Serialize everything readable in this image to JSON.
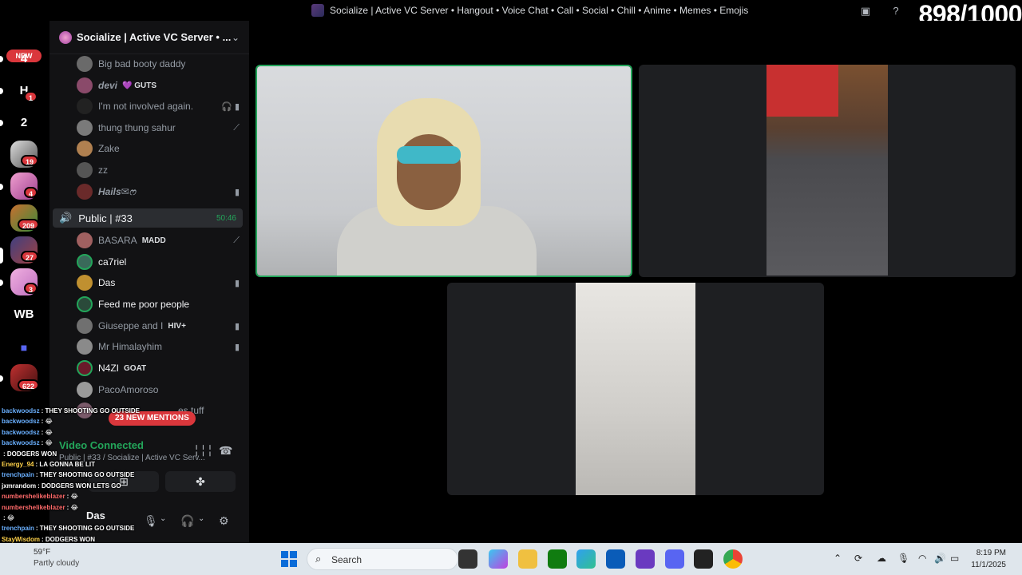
{
  "window": {
    "title": "Socialize | Active VC Server • Hangout • Voice Chat • Call • Social • Chill • Anime • Memes • Emojis",
    "counter": "898/1000"
  },
  "rail": {
    "new_pill": "NEW",
    "servers": [
      {
        "label": "4",
        "badge": ""
      },
      {
        "label": "H",
        "badge": "1"
      },
      {
        "label": "2",
        "badge": ""
      },
      {
        "label": "",
        "badge": "19"
      },
      {
        "label": "",
        "badge": "4"
      },
      {
        "label": "",
        "badge": "209"
      },
      {
        "label": "",
        "badge": "27"
      },
      {
        "label": "",
        "badge": "3"
      },
      {
        "label": "WB",
        "badge": ""
      },
      {
        "label": "",
        "badge": ""
      },
      {
        "label": "",
        "badge": "622"
      }
    ]
  },
  "sidebar": {
    "server_name": "Socialize | Active VC Server • ...",
    "users_top": [
      {
        "name": "Big bad booty daddy",
        "tag": "",
        "icon": ""
      },
      {
        "name": "devi",
        "tag": "💜 GUTS",
        "icon": ""
      },
      {
        "name": "I'm not involved again.",
        "tag": "",
        "icon": "🎧 ▮"
      },
      {
        "name": "thung thung sahur",
        "tag": "",
        "icon": "⟋"
      },
      {
        "name": "Zake",
        "tag": "",
        "icon": ""
      },
      {
        "name": "zz",
        "tag": "",
        "icon": ""
      },
      {
        "name": "Hails✉ෆ",
        "tag": "",
        "icon": "▮"
      }
    ],
    "voice_channel": {
      "name": "Public | #33",
      "time": "50:46"
    },
    "users_channel": [
      {
        "name": "BASARA",
        "tag": "MADD",
        "icon": "⟋"
      },
      {
        "name": "ca7riel",
        "tag": "",
        "icon": ""
      },
      {
        "name": "Das",
        "tag": "",
        "icon": "▮"
      },
      {
        "name": "Feed me poor people",
        "tag": "",
        "icon": ""
      },
      {
        "name": "Giuseppe and I",
        "tag": "HIV+",
        "icon": "▮"
      },
      {
        "name": "Mr Himalayhim",
        "tag": "",
        "icon": "▮"
      },
      {
        "name": "N4ZI",
        "tag": "GOAT",
        "icon": ""
      },
      {
        "name": "PacoAmoroso",
        "tag": "",
        "icon": ""
      },
      {
        "name": "...es tuff",
        "tag": "",
        "icon": ""
      }
    ],
    "mentions": "23 NEW MENTIONS",
    "voice_status": "Video Connected",
    "voice_sub": "Public | #33 / Socialize | Active VC Serv...",
    "user_name": "Das"
  },
  "overlay": {
    "lines": [
      {
        "user": "backwoodsz",
        "msg": ": THEY SHOOTING GO OUTSIDE",
        "color": "#6ab0ff"
      },
      {
        "user": "backwoodsz",
        "msg": ": 😂",
        "color": "#6ab0ff"
      },
      {
        "user": "backwoodsz",
        "msg": ": 😂",
        "color": "#6ab0ff"
      },
      {
        "user": "backwoodsz",
        "msg": ": 😂",
        "color": "#6ab0ff"
      },
      {
        "user": "",
        "msg": ": DODGERS WON",
        "color": "#ff6a6a"
      },
      {
        "user": "Energy_94",
        "msg": ": LA GONNA BE LIT",
        "color": "#ffd24a"
      },
      {
        "user": "trenchpain",
        "msg": ": THEY SHOOTING GO OUTSIDE",
        "color": "#6ab0ff"
      },
      {
        "user": "jxmrandom",
        "msg": ": DODGERS WON LETS GO",
        "color": "#ffffff"
      },
      {
        "user": "numbershelikeblazer",
        "msg": ": 😂",
        "color": "#ff6a6a"
      },
      {
        "user": "numbershelikeblazer",
        "msg": ": 😂",
        "color": "#ff6a6a"
      },
      {
        "user": "",
        "msg": ": 😂",
        "color": "#ff6a6a"
      },
      {
        "user": "trenchpain",
        "msg": ": THEY SHOOTING GO OUTSIDE",
        "color": "#6ab0ff"
      },
      {
        "user": "StayWisdom",
        "msg": ": DODGERS WON",
        "color": "#ffd24a"
      }
    ]
  },
  "taskbar": {
    "search": "Search",
    "weather_temp": "59°F",
    "weather": "Partly cloudy",
    "time": "8:19 PM",
    "date": "11/1/2025"
  }
}
